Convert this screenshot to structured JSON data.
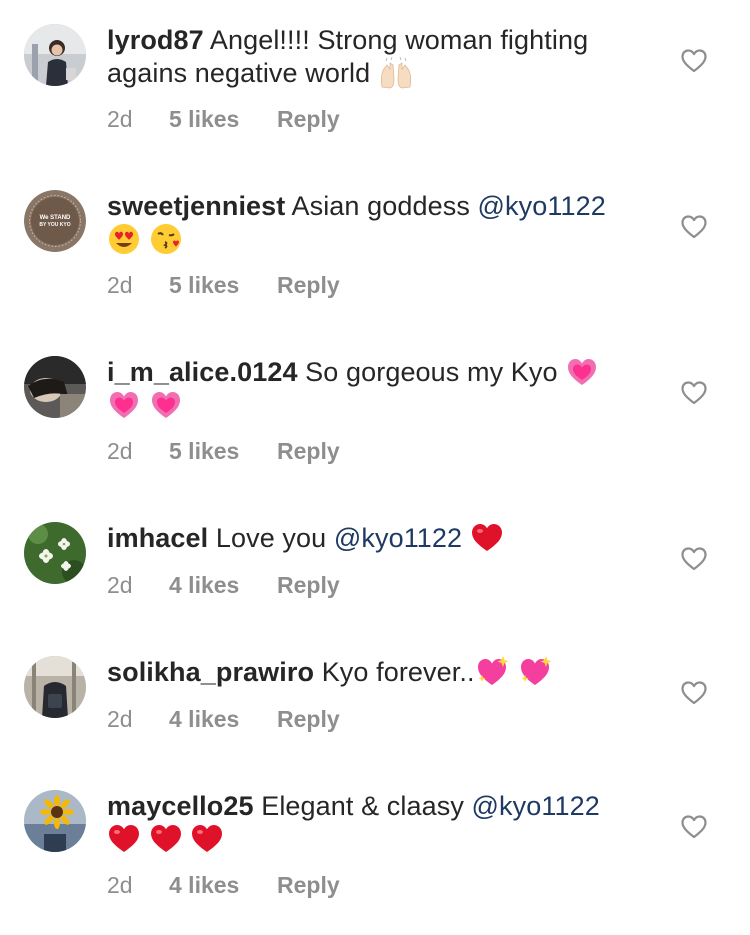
{
  "comments": [
    {
      "username": "lyrod87",
      "parts": [
        "Angel!!!! Strong woman fighting agains negative world"
      ],
      "mention": "",
      "emojis": [
        "raising-hands"
      ],
      "time": "2d",
      "likes": "5 likes",
      "reply": "Reply"
    },
    {
      "username": "sweetjenniest",
      "parts": [
        "Asian goddess"
      ],
      "mention": "@kyo1122",
      "emojis": [
        "heart-eyes",
        "kissing-face"
      ],
      "time": "2d",
      "likes": "5 likes",
      "reply": "Reply"
    },
    {
      "username": "i_m_alice.0124",
      "parts": [
        "So gorgeous my Kyo"
      ],
      "mention": "",
      "emojis": [
        "growing-heart",
        "growing-heart",
        "growing-heart"
      ],
      "time": "2d",
      "likes": "5 likes",
      "reply": "Reply"
    },
    {
      "username": "imhacel",
      "parts": [
        "Love you"
      ],
      "mention": "@kyo1122",
      "emojis": [
        "red-heart"
      ],
      "time": "2d",
      "likes": "4 likes",
      "reply": "Reply"
    },
    {
      "username": "solikha_prawiro",
      "parts": [
        "Kyo forever.."
      ],
      "mention": "",
      "emojis": [
        "sparkling-heart",
        "sparkling-heart"
      ],
      "time": "2d",
      "likes": "4 likes",
      "reply": "Reply"
    },
    {
      "username": "maycello25",
      "parts": [
        "Elegant & claasy"
      ],
      "mention": "@kyo1122",
      "emojis": [
        "red-heart",
        "red-heart",
        "red-heart"
      ],
      "time": "2d",
      "likes": "4 likes",
      "reply": "Reply"
    }
  ],
  "avatar_badge_text": "We STAND BY YOU KYO",
  "colors": {
    "mention": "#1e3a62",
    "meta": "#8e8e8e",
    "text": "#262626"
  }
}
